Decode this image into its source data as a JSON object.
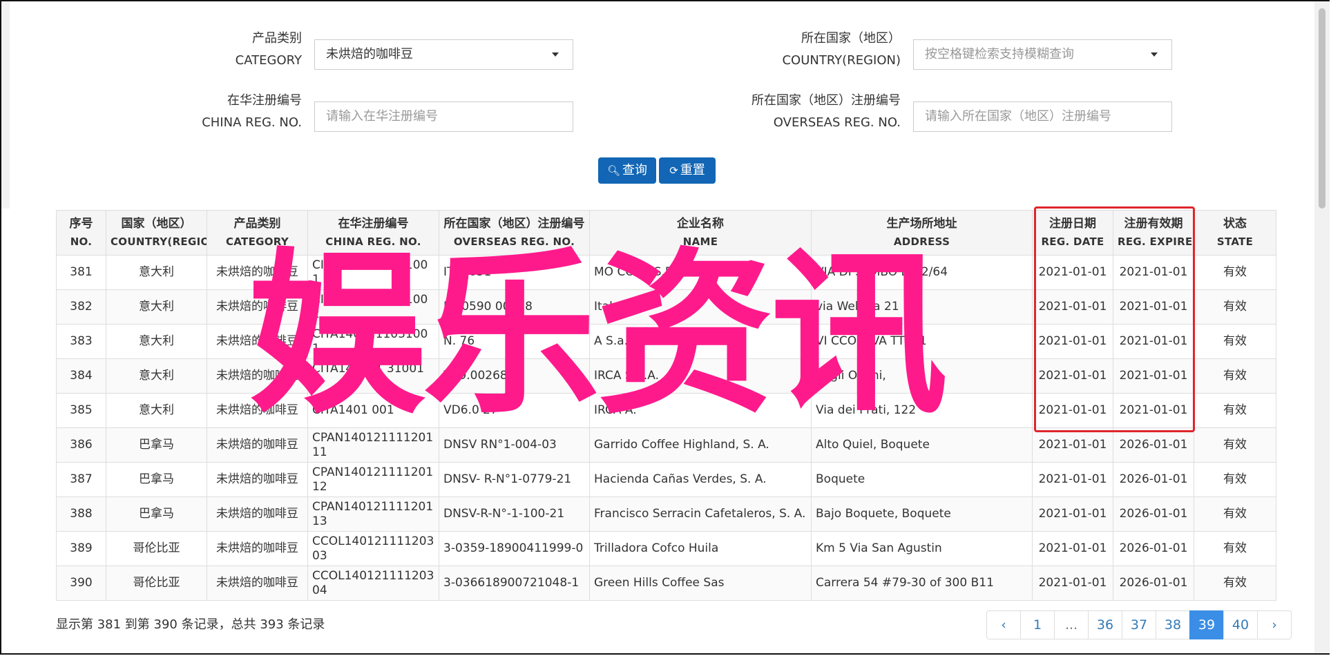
{
  "filters": {
    "category": {
      "label_cn": "产品类别",
      "label_en": "CATEGORY",
      "value": "未烘焙的咖啡豆"
    },
    "country": {
      "label_cn": "所在国家（地区）",
      "label_en": "COUNTRY(REGION)",
      "placeholder": "按空格键检索支持模糊查询"
    },
    "china_reg": {
      "label_cn": "在华注册编号",
      "label_en": "CHINA REG. NO.",
      "placeholder": "请输入在华注册编号"
    },
    "overseas_reg": {
      "label_cn": "所在国家（地区）注册编号",
      "label_en": "OVERSEAS REG. NO.",
      "placeholder": "请输入所在国家（地区）注册编号"
    }
  },
  "buttons": {
    "search": "查询",
    "reset": "重置"
  },
  "table": {
    "headers": [
      {
        "cn": "序号",
        "en": "NO."
      },
      {
        "cn": "国家（地区）",
        "en": "COUNTRY(REGIO..."
      },
      {
        "cn": "产品类别",
        "en": "CATEGORY"
      },
      {
        "cn": "在华注册编号",
        "en": "CHINA REG. NO."
      },
      {
        "cn": "所在国家（地区）注册编号",
        "en": "OVERSEAS REG. NO."
      },
      {
        "cn": "企业名称",
        "en": "NAME"
      },
      {
        "cn": "生产场所地址",
        "en": "ADDRESS"
      },
      {
        "cn": "注册日期",
        "en": "REG. DATE"
      },
      {
        "cn": "注册有效期",
        "en": "REG. EXPIRE ..."
      },
      {
        "cn": "状态",
        "en": "STATE"
      }
    ],
    "rows": [
      {
        "no": "381",
        "country": "意大利",
        "category": "未烘焙的咖啡豆",
        "china_reg": "CITA1401211031001 1",
        "overseas_reg": "IT09051",
        "name": "MO CORS S.P.A.",
        "address": "VIA DI SEMBO D 62/64",
        "reg_date": "2021-01-01",
        "expire": "2021-01-01",
        "state": "有效"
      },
      {
        "no": "382",
        "country": "意大利",
        "category": "未烘焙的咖啡豆",
        "china_reg": "CITA1401211031002",
        "overseas_reg": "IT20590 00718",
        "name": "Italvi’ srl",
        "address": "via Webbia 21",
        "reg_date": "2021-01-01",
        "expire": "2021-01-01",
        "state": "有效"
      },
      {
        "no": "383",
        "country": "意大利",
        "category": "未烘焙的咖啡豆",
        "china_reg": "CITA1401211031001",
        "overseas_reg": "N. 76",
        "name": "A S.a.s.",
        "address": "VI CCO E VA TTI 11",
        "reg_date": "2021-01-01",
        "expire": "2021-01-01",
        "state": "有效"
      },
      {
        "no": "384",
        "country": "意大利",
        "category": "未烘焙的咖啡豆",
        "china_reg": "CITA140121 31001 4",
        "overseas_reg": "V69.002687",
        "name": "IRCA S.p.A.",
        "address": "degli Orsini,",
        "reg_date": "2021-01-01",
        "expire": "2021-01-01",
        "state": "有效"
      },
      {
        "no": "385",
        "country": "意大利",
        "category": "未烘焙的咖啡豆",
        "china_reg": "CITA1401 001",
        "overseas_reg": "VD6.0 27",
        "name": "IRCA A.",
        "address": "Via dei Prati, 122",
        "reg_date": "2021-01-01",
        "expire": "2021-01-01",
        "state": "有效"
      },
      {
        "no": "386",
        "country": "巴拿马",
        "category": "未烘焙的咖啡豆",
        "china_reg": "CPAN140121111201 11",
        "overseas_reg": "DNSV RN°1-004-03",
        "name": "Garrido Coffee Highland, S. A.",
        "address": "Alto Quiel, Boquete",
        "reg_date": "2021-01-01",
        "expire": "2026-01-01",
        "state": "有效"
      },
      {
        "no": "387",
        "country": "巴拿马",
        "category": "未烘焙的咖啡豆",
        "china_reg": "CPAN140121111201 12",
        "overseas_reg": "DNSV- R-N°1-0779-21",
        "name": "Hacienda Cañas Verdes, S. A.",
        "address": "Boquete",
        "reg_date": "2021-01-01",
        "expire": "2026-01-01",
        "state": "有效"
      },
      {
        "no": "388",
        "country": "巴拿马",
        "category": "未烘焙的咖啡豆",
        "china_reg": "CPAN140121111201 13",
        "overseas_reg": "DNSV-R-N°-1-100-21",
        "name": "Francisco Serracin Cafetaleros, S. A.",
        "address": "Bajo Boquete, Boquete",
        "reg_date": "2021-01-01",
        "expire": "2026-01-01",
        "state": "有效"
      },
      {
        "no": "389",
        "country": "哥伦比亚",
        "category": "未烘焙的咖啡豆",
        "china_reg": "CCOL140121111203 03",
        "overseas_reg": "3-0359-18900411999-0",
        "name": "Trilladora Cofco Huila",
        "address": "Km 5 Via San Agustin",
        "reg_date": "2021-01-01",
        "expire": "2026-01-01",
        "state": "有效"
      },
      {
        "no": "390",
        "country": "哥伦比亚",
        "category": "未烘焙的咖啡豆",
        "china_reg": "CCOL140121111203 04",
        "overseas_reg": "3-036618900721048-1",
        "name": "Green Hills Coffee Sas",
        "address": "Carrera 54 #79-30 of 300 B11",
        "reg_date": "2021-01-01",
        "expire": "2026-01-01",
        "state": "有效"
      }
    ]
  },
  "watermark": "娱乐资讯",
  "summary": "显示第 381 到第 390 条记录，总共 393 条记录",
  "pagination": {
    "prev": "‹",
    "next": "›",
    "ellipsis": "...",
    "pages": [
      "1",
      "36",
      "37",
      "38",
      "39",
      "40"
    ],
    "active": "39"
  },
  "colors": {
    "primary_button": "#1266b5",
    "active_page": "#3a8ee6",
    "highlight_box": "#e0252b",
    "watermark": "#ff1a8c"
  }
}
